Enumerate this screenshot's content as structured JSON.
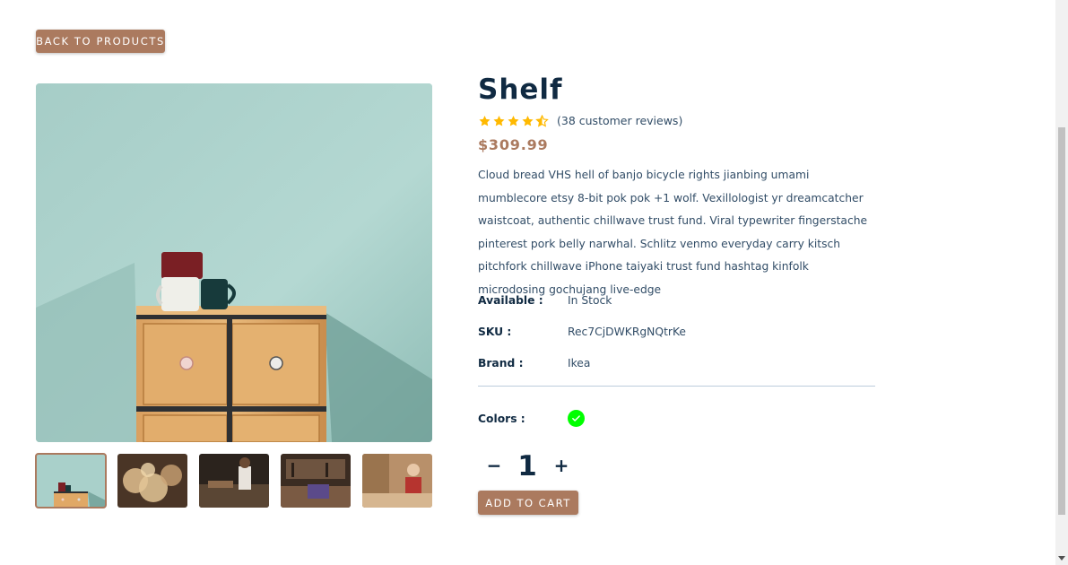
{
  "nav": {
    "back_label": "back to products"
  },
  "gallery": {
    "main_alt": "shelf",
    "thumbnails": [
      "shelf",
      "wood shavings",
      "workshop",
      "workshop tools",
      "carpenter"
    ]
  },
  "product": {
    "name": "Shelf",
    "rating": 4.5,
    "stars_max": 5,
    "reviews_text": "(38 customer reviews)",
    "price": "$309.99",
    "description": "Cloud bread VHS hell of banjo bicycle rights jianbing umami mumblecore etsy 8-bit pok pok +1 wolf. Vexillologist yr dreamcatcher waistcoat, authentic chillwave trust fund. Viral typewriter fingerstache pinterest pork belly narwhal. Schlitz venmo everyday carry kitsch pitchfork chillwave iPhone taiyaki trust fund hashtag kinfolk microdosing gochujang live-edge",
    "details": [
      {
        "label": "Available :",
        "value": "In Stock"
      },
      {
        "label": "SKU :",
        "value": "Rec7CjDWKRgNQtrKe"
      },
      {
        "label": "Brand :",
        "value": "Ikea"
      }
    ],
    "colors_label": "Colors :",
    "colors": [
      "#00ff00"
    ],
    "quantity": "1",
    "decrease_symbol": "−",
    "increase_symbol": "+",
    "add_to_cart_label": "add to cart"
  },
  "theme": {
    "accent": "#ab7a5f",
    "heading": "#102a42",
    "text": "#324d67",
    "star": "#ffb900"
  }
}
